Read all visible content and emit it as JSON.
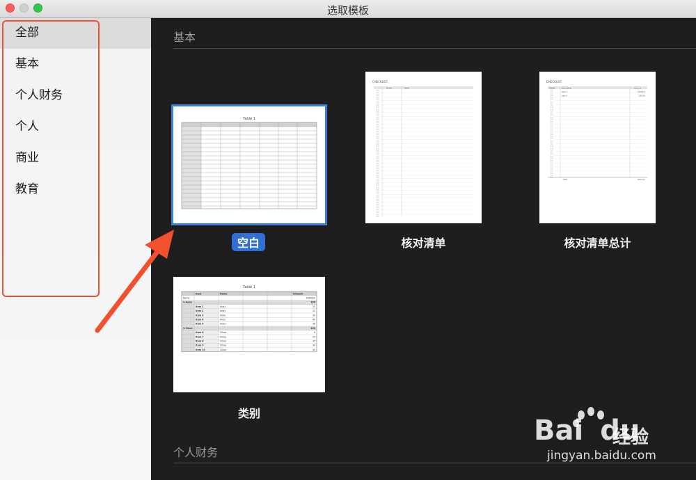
{
  "window": {
    "title": "选取模板"
  },
  "sidebar": {
    "items": [
      {
        "label": "全部",
        "selected": true
      },
      {
        "label": "基本"
      },
      {
        "label": "个人财务"
      },
      {
        "label": "个人"
      },
      {
        "label": "商业"
      },
      {
        "label": "教育"
      }
    ]
  },
  "sections": [
    {
      "title": "基本"
    },
    {
      "title": "个人财务"
    }
  ],
  "templates": [
    {
      "label": "空白",
      "selected": true,
      "preview_title": "Table 1"
    },
    {
      "label": "核对清单",
      "preview_heading": "CHECKLIST",
      "preview_cols": [
        "Done",
        "Task"
      ]
    },
    {
      "label": "核对清单总计",
      "preview_heading": "CHECKLIST",
      "preview_cols": [
        "Yes/No",
        "Description",
        "Amount"
      ],
      "preview_rows": [
        {
          "desc": "Item 1",
          "amt": "$100.00"
        },
        {
          "desc": "Item 2",
          "amt": "$50.00"
        }
      ],
      "preview_total_label": "Total",
      "preview_total": "$150.00"
    },
    {
      "label": "类别",
      "preview_title": "Table 1",
      "preview_header": [
        "Item",
        "Name",
        "Amount"
      ],
      "preview_subheader": [
        "Name",
        "Subtotal"
      ],
      "groups": [
        {
          "name": "Andy",
          "subtotal": "150",
          "rows": [
            {
              "item": "Item 1",
              "name": "Andy",
              "amount": "15"
            },
            {
              "item": "Item 2",
              "name": "Andy",
              "amount": "25"
            },
            {
              "item": "Item 3",
              "name": "Andy",
              "amount": "30"
            },
            {
              "item": "Item 4",
              "name": "Andy",
              "amount": "40"
            },
            {
              "item": "Item 5",
              "name": "Andy",
              "amount": "38"
            }
          ]
        },
        {
          "name": "Chloe",
          "subtotal": "100",
          "rows": [
            {
              "item": "Item 6",
              "name": "Chloe",
              "amount": "9"
            },
            {
              "item": "Item 7",
              "name": "Chloe",
              "amount": "15"
            },
            {
              "item": "Item 8",
              "name": "Chloe",
              "amount": "25"
            },
            {
              "item": "Item 9",
              "name": "Chloe",
              "amount": "34"
            },
            {
              "item": "Item 10",
              "name": "Chloe",
              "amount": "45"
            }
          ]
        }
      ]
    }
  ],
  "watermark": {
    "brand": "Bai",
    "brand2": "du",
    "cn": "经验",
    "url": "jingyan.baidu.com"
  },
  "colors": {
    "accent": "#2f6fd6",
    "annotation": "#f2502f"
  }
}
